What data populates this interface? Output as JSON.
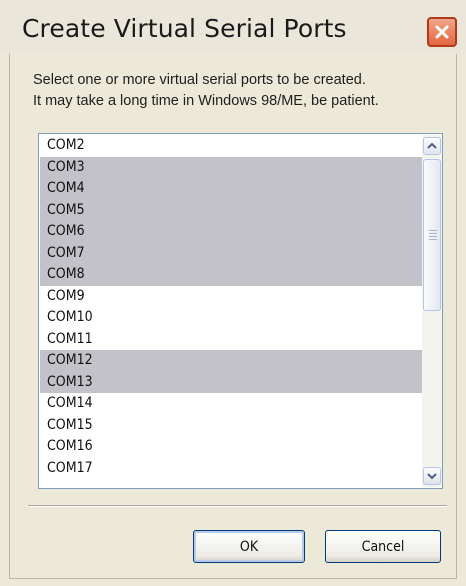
{
  "window": {
    "title": "Create Virtual Serial Ports"
  },
  "instructions": [
    "Select one or more virtual serial ports to be created.",
    "It may take a long time in Windows 98/ME, be patient."
  ],
  "ports": [
    {
      "label": "COM2",
      "selected": false
    },
    {
      "label": "COM3",
      "selected": true
    },
    {
      "label": "COM4",
      "selected": true
    },
    {
      "label": "COM5",
      "selected": true
    },
    {
      "label": "COM6",
      "selected": true
    },
    {
      "label": "COM7",
      "selected": true
    },
    {
      "label": "COM8",
      "selected": true
    },
    {
      "label": "COM9",
      "selected": false
    },
    {
      "label": "COM10",
      "selected": false
    },
    {
      "label": "COM11",
      "selected": false
    },
    {
      "label": "COM12",
      "selected": true
    },
    {
      "label": "COM13",
      "selected": true
    },
    {
      "label": "COM14",
      "selected": false
    },
    {
      "label": "COM15",
      "selected": false
    },
    {
      "label": "COM16",
      "selected": false
    },
    {
      "label": "COM17",
      "selected": false
    }
  ],
  "buttons": {
    "ok": "OK",
    "cancel": "Cancel"
  },
  "icons": {
    "close": "close-icon",
    "scroll_up": "chevron-up-icon",
    "scroll_down": "chevron-down-icon"
  },
  "colors": {
    "selection": "#c2c2c8",
    "window_bg": "#ece9d8",
    "close_button": "#e2663f"
  }
}
